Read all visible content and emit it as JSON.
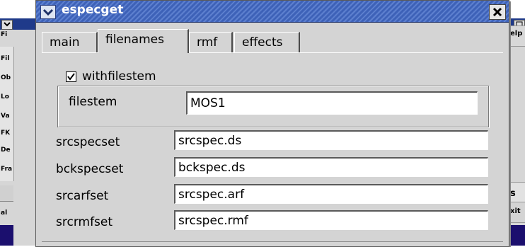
{
  "dialog": {
    "title": "especget",
    "tabs": [
      {
        "label": "main",
        "active": false
      },
      {
        "label": "filenames",
        "active": true
      },
      {
        "label": "rmf",
        "active": false
      },
      {
        "label": "effects",
        "active": false
      }
    ],
    "withfilestem": {
      "label": "withfilestem",
      "checked": true
    },
    "filestem": {
      "label": "filestem",
      "value": "MOS1"
    },
    "fields": [
      {
        "label": "srcspecset",
        "value": "srcspec.ds"
      },
      {
        "label": "bckspecset",
        "value": "bckspec.ds"
      },
      {
        "label": "srcarfset",
        "value": "srcspec.arf"
      },
      {
        "label": "srcrmfset",
        "value": "srcspec.rmf"
      }
    ]
  },
  "background_window": {
    "top_left_label": "Fi",
    "left_labels": [
      "Fil",
      "Ob",
      "Lo",
      "Va",
      "FK",
      "De",
      "Fra"
    ],
    "bottom_left_label": "al",
    "right_labels": {
      "help": "elp",
      "s": "s",
      "exit": "xit"
    }
  },
  "colors": {
    "titlebar": "#3e62b8",
    "dialog_bg": "#d4d4d4",
    "background_dark": "#1b0f6e"
  }
}
